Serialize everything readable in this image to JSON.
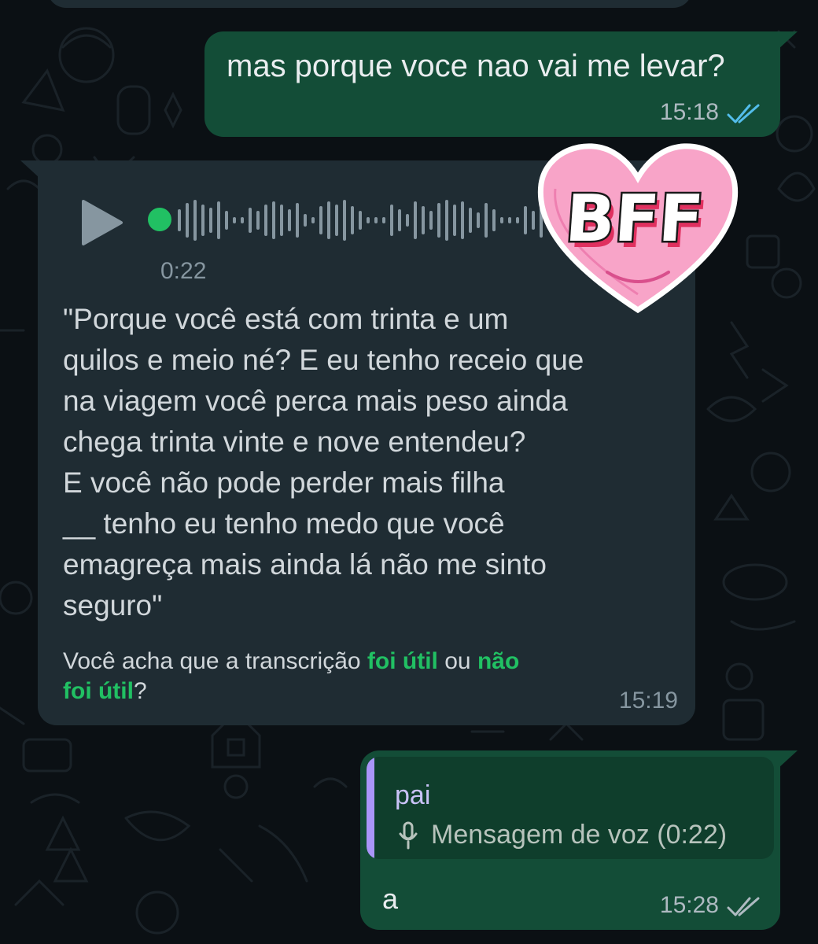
{
  "messages": [
    {
      "direction": "outgoing",
      "text": "mas porque voce nao vai me levar?",
      "time": "15:18",
      "status": "read",
      "status_icon": "double-check-icon",
      "status_color": "#53bdeb"
    },
    {
      "direction": "incoming",
      "type": "voice",
      "duration": "0:22",
      "transcript_lines": [
        "\"Porque você está com trinta e um",
        "quilos e meio né? E eu tenho receio que",
        "na viagem você perca mais peso ainda",
        "chega trinta vinte e nove entendeu?",
        "E você não pode perder mais filha",
        "__ tenho eu tenho medo que você",
        "emagreça mais ainda lá não me sinto",
        "seguro\""
      ],
      "feedback": {
        "prefix": "Você acha que a transcrição ",
        "useful": "foi útil",
        "middle": " ou ",
        "not_useful_part1": "não",
        "not_useful_part2": "foi útil",
        "suffix": "?"
      },
      "time": "15:19"
    },
    {
      "direction": "outgoing",
      "quoted": {
        "author": "pai",
        "icon": "microphone-icon",
        "text": "Mensagem de voz (0:22)"
      },
      "text": "a",
      "time": "15:28",
      "status": "delivered",
      "status_icon": "double-check-icon",
      "status_color": "#aebac1"
    }
  ],
  "sticker": {
    "text": "BFF",
    "icon": "heart-bff-sticker"
  },
  "colors": {
    "background": "#0b1014",
    "outgoing_bubble": "#134d37",
    "incoming_bubble": "#1f2c33",
    "accent_green": "#21c063",
    "read_blue": "#53bdeb",
    "sticker_pink": "#f8a4c8"
  }
}
